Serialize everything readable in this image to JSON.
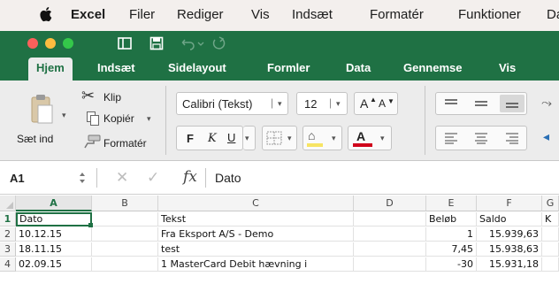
{
  "menubar": {
    "app": "Excel",
    "items": [
      "Filer",
      "Rediger",
      "Vis",
      "Indsæt",
      "Formatér",
      "Funktioner",
      "Da"
    ]
  },
  "ribbon_tabs": [
    "Hjem",
    "Indsæt",
    "Sidelayout",
    "Formler",
    "Data",
    "Gennemse",
    "Vis"
  ],
  "active_tab": "Hjem",
  "clipboard": {
    "paste_label": "Sæt ind",
    "cut_label": "Klip",
    "copy_label": "Kopiér",
    "format_painter_label": "Formatér"
  },
  "font": {
    "name": "Calibri (Tekst)",
    "size": "12",
    "bold": "F",
    "italic": "K",
    "underline": "U",
    "grow": "A",
    "shrink": "A",
    "font_color_label": "A"
  },
  "formula_bar": {
    "cell_ref": "A1",
    "fx": "fx",
    "value": "Dato"
  },
  "sheet": {
    "columns": [
      "A",
      "B",
      "C",
      "D",
      "E",
      "F",
      "G"
    ],
    "rows": [
      {
        "num": "1",
        "A": "Dato",
        "B": "",
        "C": "Tekst",
        "D": "",
        "E": "Beløb",
        "F": "Saldo",
        "G": "K"
      },
      {
        "num": "2",
        "A": "10.12.15",
        "B": "",
        "C": "Fra Eksport A/S - Demo",
        "D": "",
        "E": "1",
        "F": "15.939,63",
        "G": ""
      },
      {
        "num": "3",
        "A": "18.11.15",
        "B": "",
        "C": "test",
        "D": "",
        "E": "7,45",
        "F": "15.938,63",
        "G": ""
      },
      {
        "num": "4",
        "A": "02.09.15",
        "B": "",
        "C": "1 MasterCard Debit hævning i",
        "D": "",
        "E": "-30",
        "F": "15.931,18",
        "G": ""
      }
    ]
  },
  "colors": {
    "excel_green": "#1f7144",
    "font_color_red": "#d0021b",
    "highlight_yellow": "#f7e463"
  }
}
